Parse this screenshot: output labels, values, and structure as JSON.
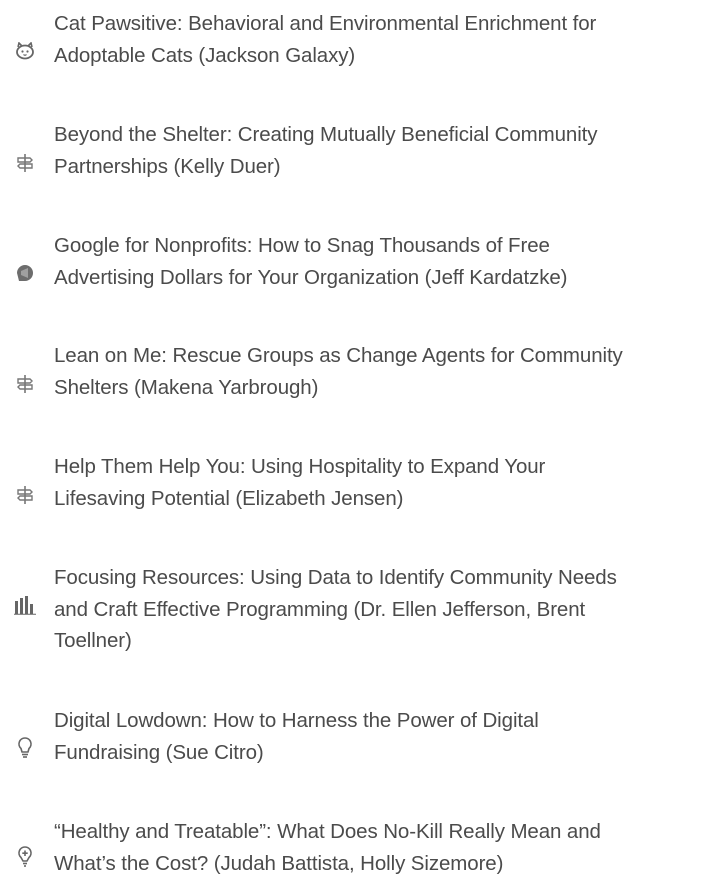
{
  "sessions": [
    {
      "icon": "cat-icon",
      "lines": [
        "Cat Pawsitive: Behavioral and Environmental Enrichment for",
        "Adoptable Cats (Jackson Galaxy)"
      ]
    },
    {
      "icon": "signpost-icon",
      "lines": [
        "Beyond the Shelter: Creating Mutually Beneficial Community",
        "Partnerships (Kelly Duer)"
      ]
    },
    {
      "icon": "megaphone-icon",
      "lines": [
        "Google for Nonprofits: How to Snag Thousands of Free",
        "Advertising Dollars for Your Organization (Jeff Kardatzke)"
      ]
    },
    {
      "icon": "signpost-icon",
      "lines": [
        "Lean on Me: Rescue Groups as Change Agents for Community",
        "Shelters (Makena Yarbrough)"
      ]
    },
    {
      "icon": "signpost-icon",
      "lines": [
        "Help Them Help You: Using Hospitality to Expand Your",
        "Lifesaving Potential (Elizabeth Jensen)"
      ]
    },
    {
      "icon": "bar-chart-icon",
      "lines": [
        "Focusing Resources: Using Data to Identify Community Needs",
        "and Craft Effective Programming (Dr. Ellen Jefferson, Brent",
        "Toellner)"
      ]
    },
    {
      "icon": "lightbulb-icon",
      "lines": [
        "Digital Lowdown: How to Harness the Power of Digital",
        "Fundraising (Sue Citro)"
      ]
    },
    {
      "icon": "medical-icon",
      "lines": [
        "“Healthy and Treatable”: What Does No-Kill Really Mean and",
        "What’s the Cost? (Judah Battista, Holly Sizemore)"
      ]
    }
  ]
}
